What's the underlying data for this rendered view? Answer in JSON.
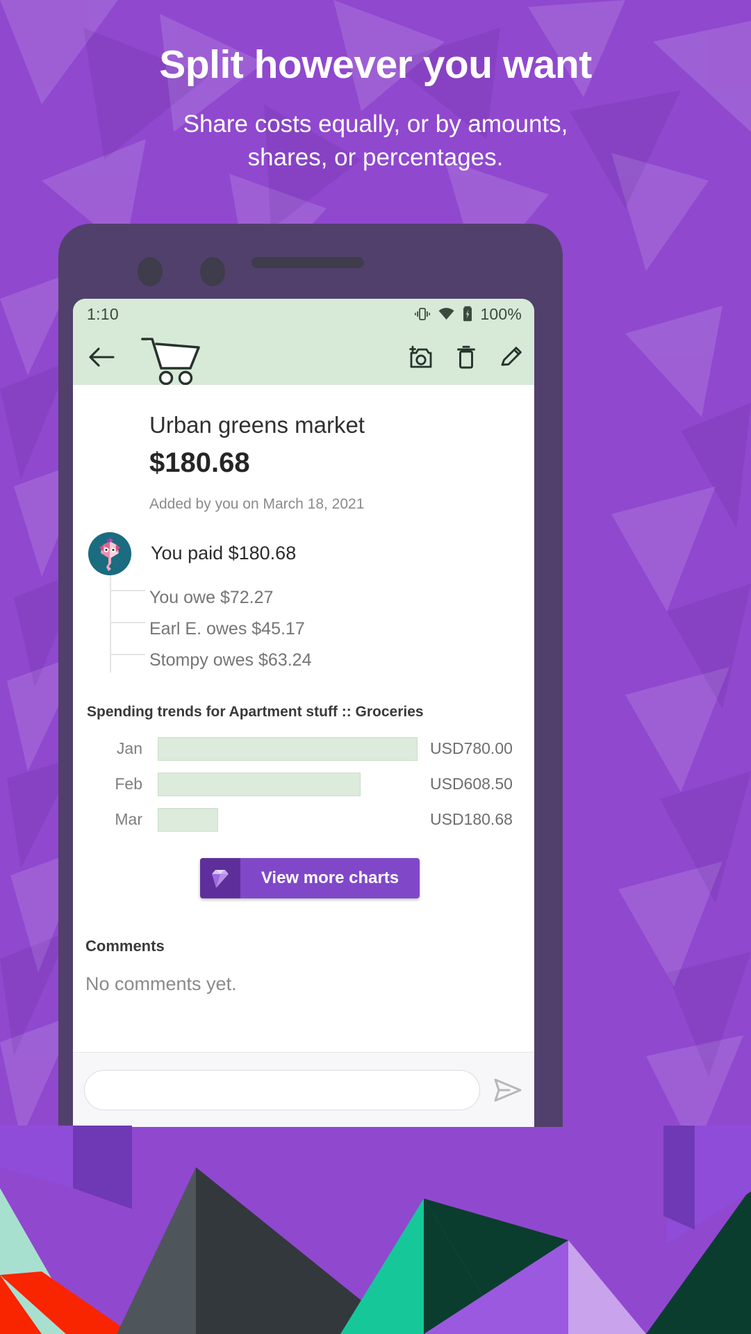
{
  "promo": {
    "title": "Split however you want",
    "subtitle_line1": "Share costs equally, or by amounts,",
    "subtitle_line2": "shares, or percentages."
  },
  "colors": {
    "backdrop_purple": "#9048CF",
    "phone_frame": "#51406B",
    "appbar_green": "#D7E9D7",
    "bar_fill": "#DCEBDC",
    "button_purple": "#8048C8",
    "button_icon_purple": "#5E2F9A",
    "avatar_teal": "#1B6C81",
    "deco_teal": "#16C79A",
    "deco_dark_green": "#0B3D2E",
    "deco_charcoal": "#33383D",
    "deco_slate": "#4E565C",
    "deco_red": "#F92400",
    "deco_mint": "#A8E0D0",
    "deco_light_purple": "#C9A3EC"
  },
  "statusbar": {
    "time": "1:10",
    "battery_text": "100%",
    "icons": [
      "vibrate-icon",
      "wifi-icon",
      "battery-charging-icon"
    ]
  },
  "appbar": {
    "back_label": "back-arrow",
    "category_icon": "shopping-cart-icon",
    "actions": [
      {
        "name": "add-receipt-photo-button",
        "icon": "add-a-photo-icon"
      },
      {
        "name": "delete-expense-button",
        "icon": "trash-icon"
      },
      {
        "name": "edit-expense-button",
        "icon": "pencil-icon"
      }
    ]
  },
  "expense": {
    "title": "Urban greens market",
    "amount": "$180.68",
    "meta": "Added by you on March 18, 2021",
    "paid_text": "You paid $180.68",
    "splits": [
      "You owe $72.27",
      "Earl E. owes $45.17",
      "Stompy owes $63.24"
    ]
  },
  "trends": {
    "title": "Spending trends for Apartment stuff :: Groceries",
    "button_label": "View more charts",
    "button_icon": "gem-icon"
  },
  "comments": {
    "title": "Comments",
    "empty_text": "No comments yet.",
    "composer_placeholder": "",
    "send_icon": "send-icon"
  },
  "chart_data": {
    "type": "bar",
    "title": "Spending trends for Apartment stuff :: Groceries",
    "orientation": "horizontal",
    "categories": [
      "Jan",
      "Feb",
      "Mar"
    ],
    "values": [
      780.0,
      608.5,
      180.68
    ],
    "value_labels": [
      "USD780.00",
      "USD608.50",
      "USD180.68"
    ],
    "currency": "USD",
    "xlabel": "",
    "ylabel": "",
    "xlim": [
      0,
      780
    ],
    "grid": false,
    "legend": null,
    "bar_color": "#DCEBDC",
    "bar_border_color": "#C9DDC9"
  }
}
